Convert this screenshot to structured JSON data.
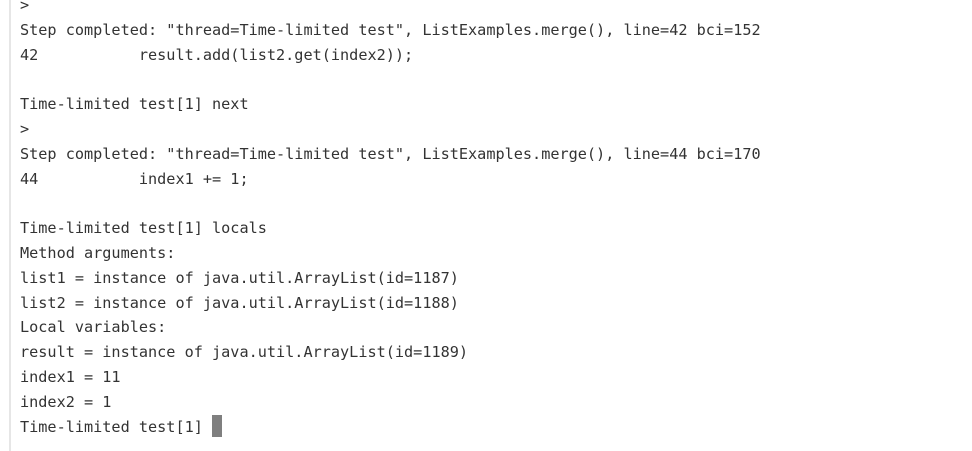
{
  "terminal": {
    "lines": [
      ">",
      "Step completed: \"thread=Time-limited test\", ListExamples.merge(), line=42 bci=152",
      "42           result.add(list2.get(index2));",
      "",
      "Time-limited test[1] next",
      ">",
      "Step completed: \"thread=Time-limited test\", ListExamples.merge(), line=44 bci=170",
      "44           index1 += 1;",
      "",
      "Time-limited test[1] locals",
      "Method arguments:",
      "list1 = instance of java.util.ArrayList(id=1187)",
      "list2 = instance of java.util.ArrayList(id=1188)",
      "Local variables:",
      "result = instance of java.util.ArrayList(id=1189)",
      "index1 = 11",
      "index2 = 1"
    ],
    "prompt": "Time-limited test[1] "
  }
}
